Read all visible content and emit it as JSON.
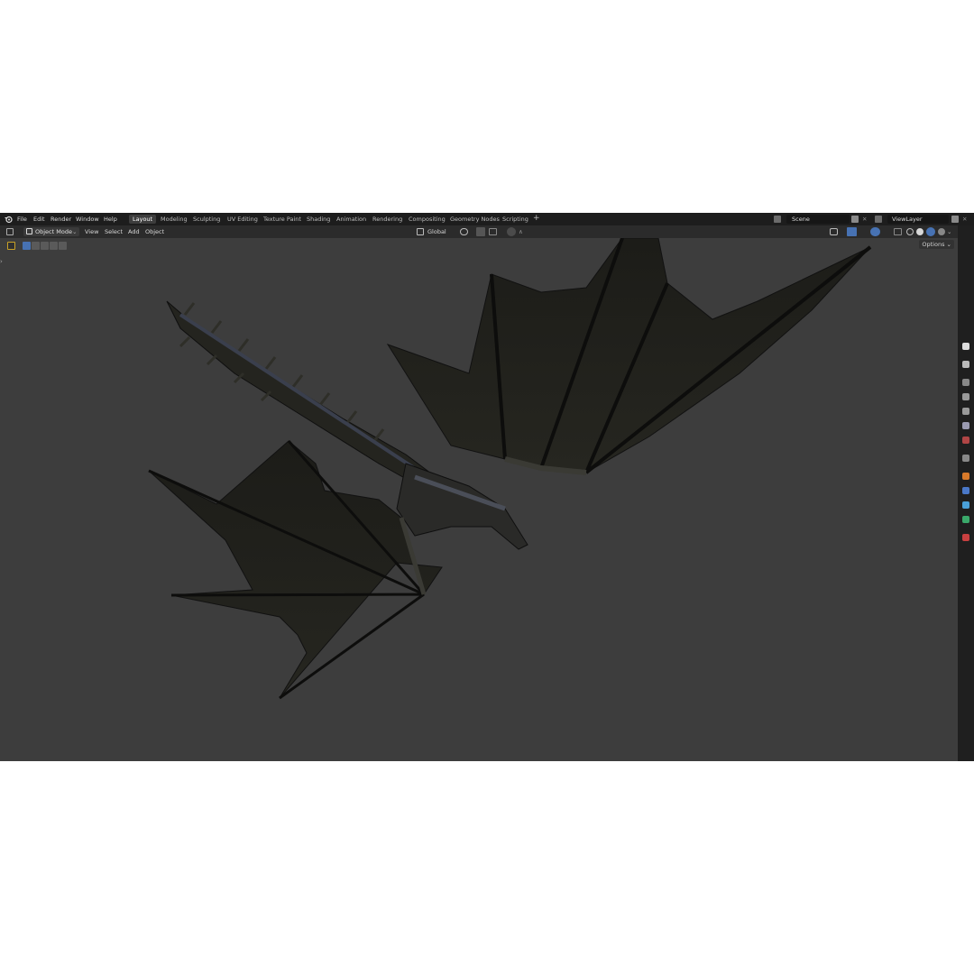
{
  "menu": [
    "File",
    "Edit",
    "Render",
    "Window",
    "Help"
  ],
  "workspaces": [
    "Layout",
    "Modeling",
    "Sculpting",
    "UV Editing",
    "Texture Paint",
    "Shading",
    "Animation",
    "Rendering",
    "Compositing",
    "Geometry Nodes",
    "Scripting"
  ],
  "active_workspace": "Layout",
  "add_workspace": "+",
  "scene": {
    "label": "Scene"
  },
  "view_layer": {
    "label": "ViewLayer"
  },
  "header": {
    "mode": "Object Mode",
    "view": "View",
    "select": "Select",
    "add": "Add",
    "object": "Object",
    "orientation": "Global",
    "options": "Options"
  },
  "colors": {
    "accent": "#4772b3",
    "background": "#3d3d3d",
    "topbar": "#1d1d1d"
  },
  "icons": [
    "blender-logo-icon",
    "editor-type-icon",
    "object-mode-icon",
    "snap-icon",
    "proportional-edit-icon",
    "overlay-icon",
    "shading-solid-icon",
    "shading-material-icon",
    "shading-rendered-icon"
  ]
}
